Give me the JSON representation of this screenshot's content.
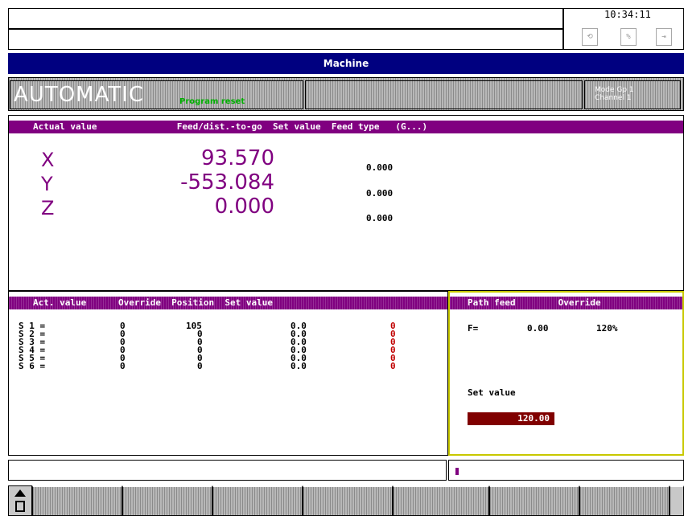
{
  "header": {
    "time": "10:34:11",
    "icons": [
      "channel-switch-icon",
      "percent-icon",
      "exit-icon"
    ],
    "icon_glyphs": [
      "⟲",
      "%",
      "⇥"
    ]
  },
  "window_title": "Machine",
  "mode_bar": {
    "mode": "AUTOMATIC",
    "status": "Program reset",
    "channel_label_1": "Mode Gp 1",
    "channel_label_2": "Channel 1"
  },
  "axes_panel": {
    "header": "Actual value               Feed/dist.-to-go  Set value  Feed type   (G...)",
    "rows": [
      {
        "axis": "X",
        "value": "93.570",
        "dtg": "0.000"
      },
      {
        "axis": "Y",
        "value": "-553.084",
        "dtg": "0.000"
      },
      {
        "axis": "Z",
        "value": "0.000",
        "dtg": "0.000"
      }
    ]
  },
  "spindle_panel": {
    "header": "Act. value      Override  Position  Set value",
    "rows": [
      {
        "name": "S 1 =",
        "act": "0",
        "override": "105",
        "position": "0.0",
        "set": "0"
      },
      {
        "name": "S 2 =",
        "act": "0",
        "override": "0",
        "position": "0.0",
        "set": "0"
      },
      {
        "name": "S 3 =",
        "act": "0",
        "override": "0",
        "position": "0.0",
        "set": "0"
      },
      {
        "name": "S 4 =",
        "act": "0",
        "override": "0",
        "position": "0.0",
        "set": "0"
      },
      {
        "name": "S 5 =",
        "act": "0",
        "override": "0",
        "position": "0.0",
        "set": "0"
      },
      {
        "name": "S 6 =",
        "act": "0",
        "override": "0",
        "position": "0.0",
        "set": "0"
      }
    ]
  },
  "feed_panel": {
    "header": "Path feed        Override",
    "f_label": "F=",
    "f_value": "0.00",
    "override": "120%",
    "set_label": "Set value",
    "set_value": "120.00"
  },
  "softkeys": [
    "",
    "",
    "",
    "",
    "",
    "",
    "",
    ""
  ],
  "colors": {
    "title": "#000080",
    "panel_header": "#800080",
    "value": "#800080",
    "highlight": "#c8c800",
    "set_value_bg": "#800000",
    "status_green": "#00b000"
  }
}
